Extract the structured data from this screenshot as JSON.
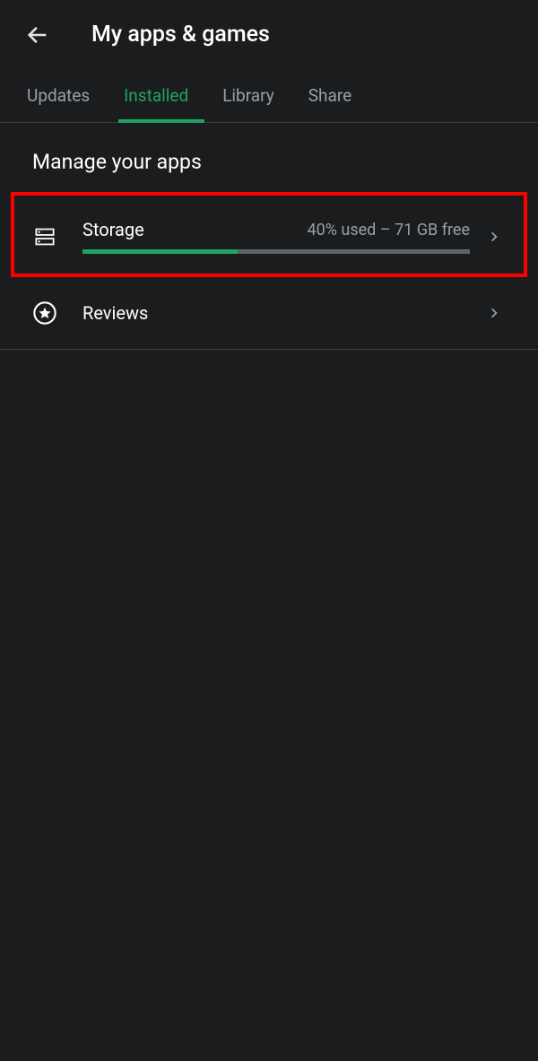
{
  "header": {
    "title": "My apps & games"
  },
  "tabs": {
    "items": [
      {
        "label": "Updates"
      },
      {
        "label": "Installed"
      },
      {
        "label": "Library"
      },
      {
        "label": "Share"
      }
    ],
    "active_index": 1
  },
  "section": {
    "title": "Manage your apps"
  },
  "storage": {
    "label": "Storage",
    "status": "40% used – 71 GB free",
    "percent_used": 40
  },
  "reviews": {
    "label": "Reviews"
  }
}
